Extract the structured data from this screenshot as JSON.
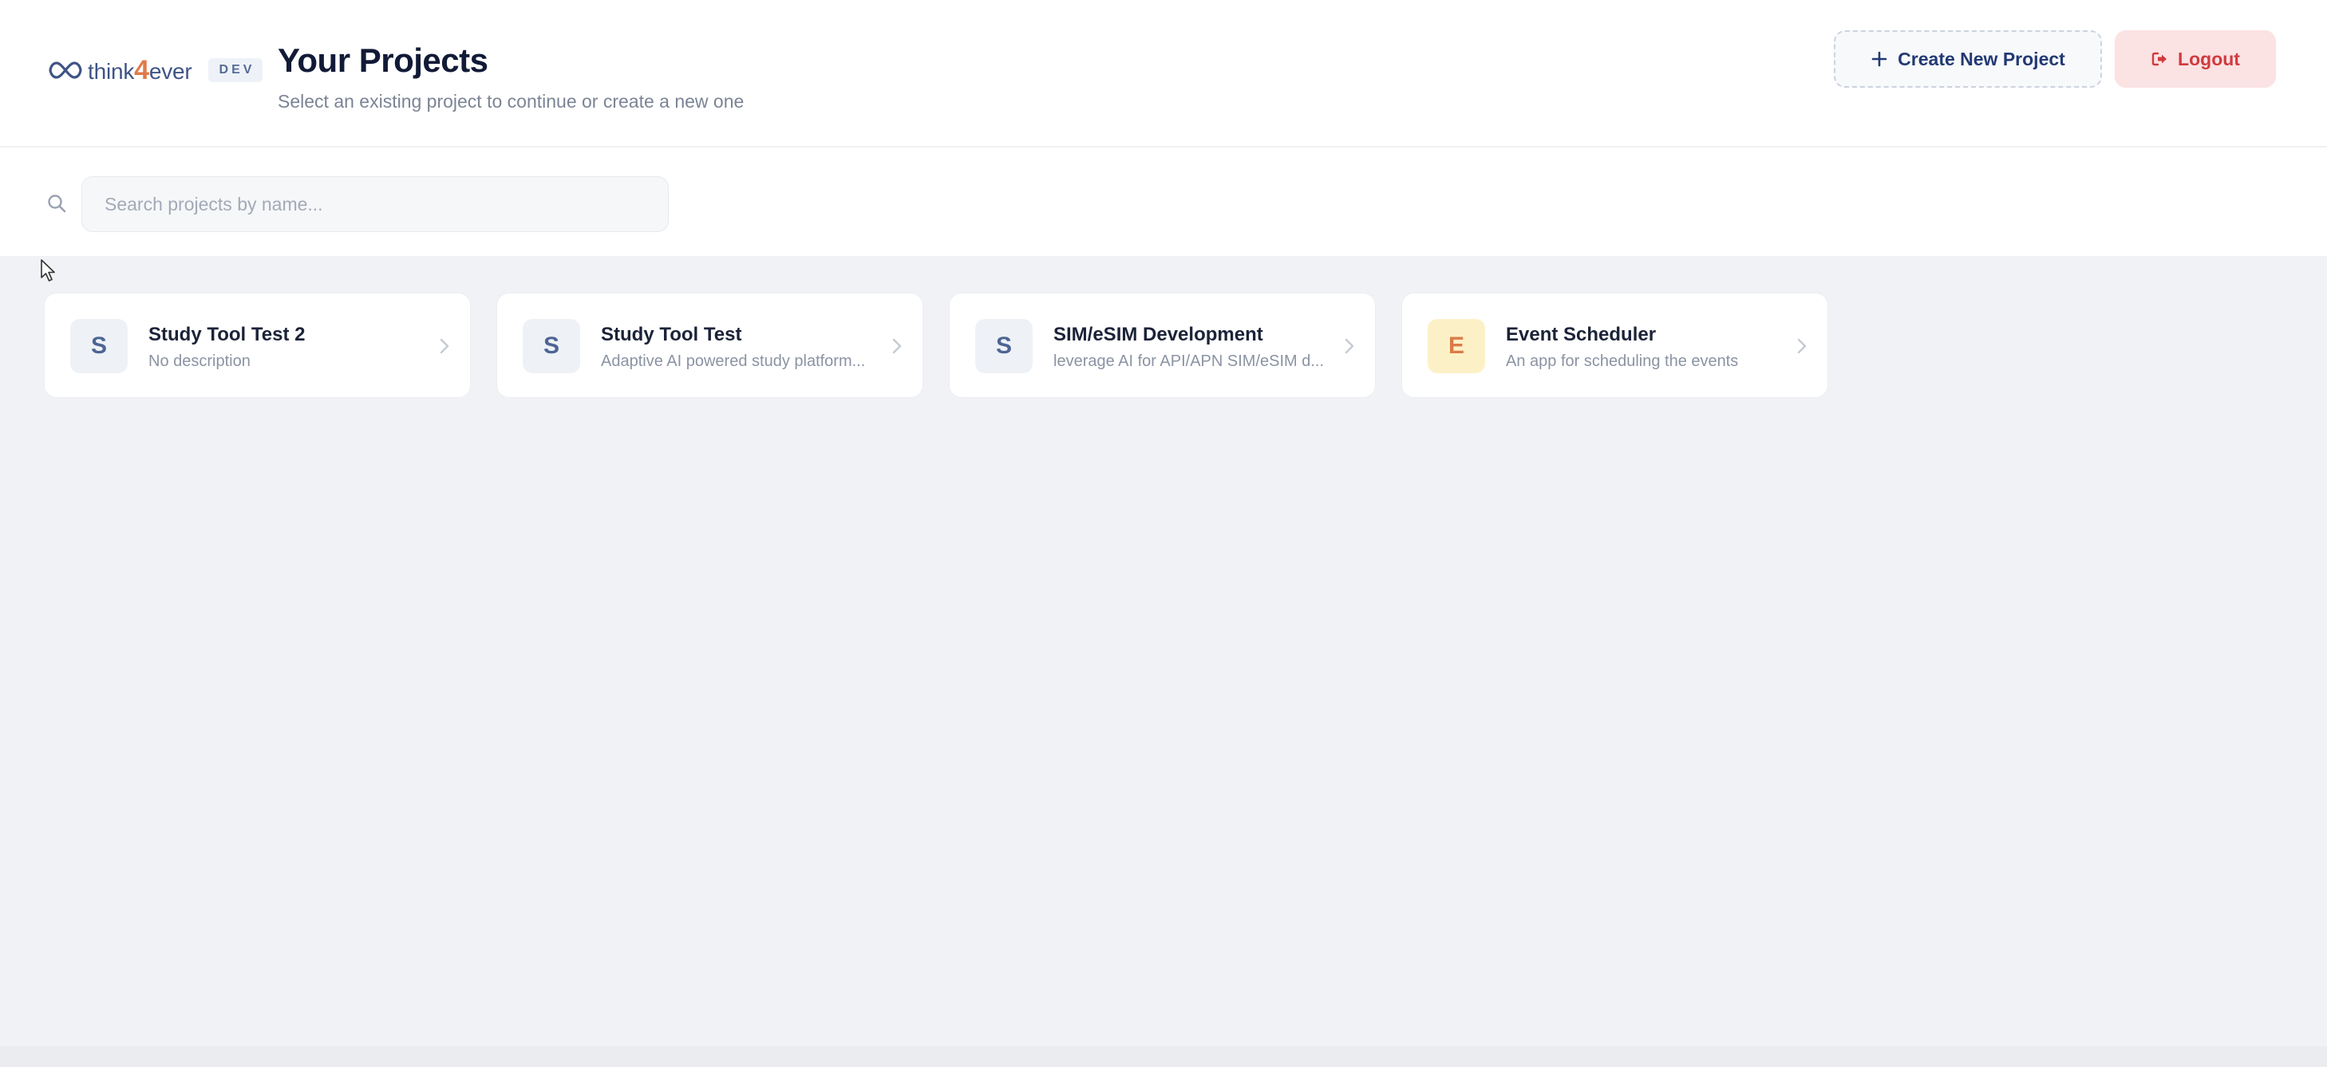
{
  "app": {
    "logo_prefix": "think",
    "logo_four": "4",
    "logo_suffix": "ever",
    "env_badge": "DEV"
  },
  "header": {
    "title": "Your Projects",
    "subtitle": "Select an existing project to continue or create a new one",
    "create_label": "Create New Project",
    "logout_label": "Logout"
  },
  "search": {
    "placeholder": "Search projects by name..."
  },
  "projects": [
    {
      "initial": "S",
      "name": "Study Tool Test 2",
      "description": "No description",
      "avatar_color": "#eef2f7"
    },
    {
      "initial": "S",
      "name": "Study Tool Test",
      "description": "Adaptive AI powered study platform...",
      "avatar_color": "#eef2f7"
    },
    {
      "initial": "S",
      "name": "SIM/eSIM Development",
      "description": "leverage AI for API/APN SIM/eSIM d...",
      "avatar_color": "#eef2f7"
    },
    {
      "initial": "E",
      "name": "Event Scheduler",
      "description": "An app for scheduling the events",
      "avatar_color": "#fcf1c6"
    }
  ],
  "colors": {
    "brand": "#3f5486",
    "accent": "#e07a4a",
    "danger": "#cf3b3f",
    "title": "#111a36",
    "background": "#f1f2f5"
  },
  "icons": {
    "logo": "infinity-icon",
    "create": "plus-icon",
    "logout": "logout-icon",
    "search": "search-icon",
    "card_chevron": "chevron-right-icon",
    "cursor": "mouse-cursor-icon"
  }
}
